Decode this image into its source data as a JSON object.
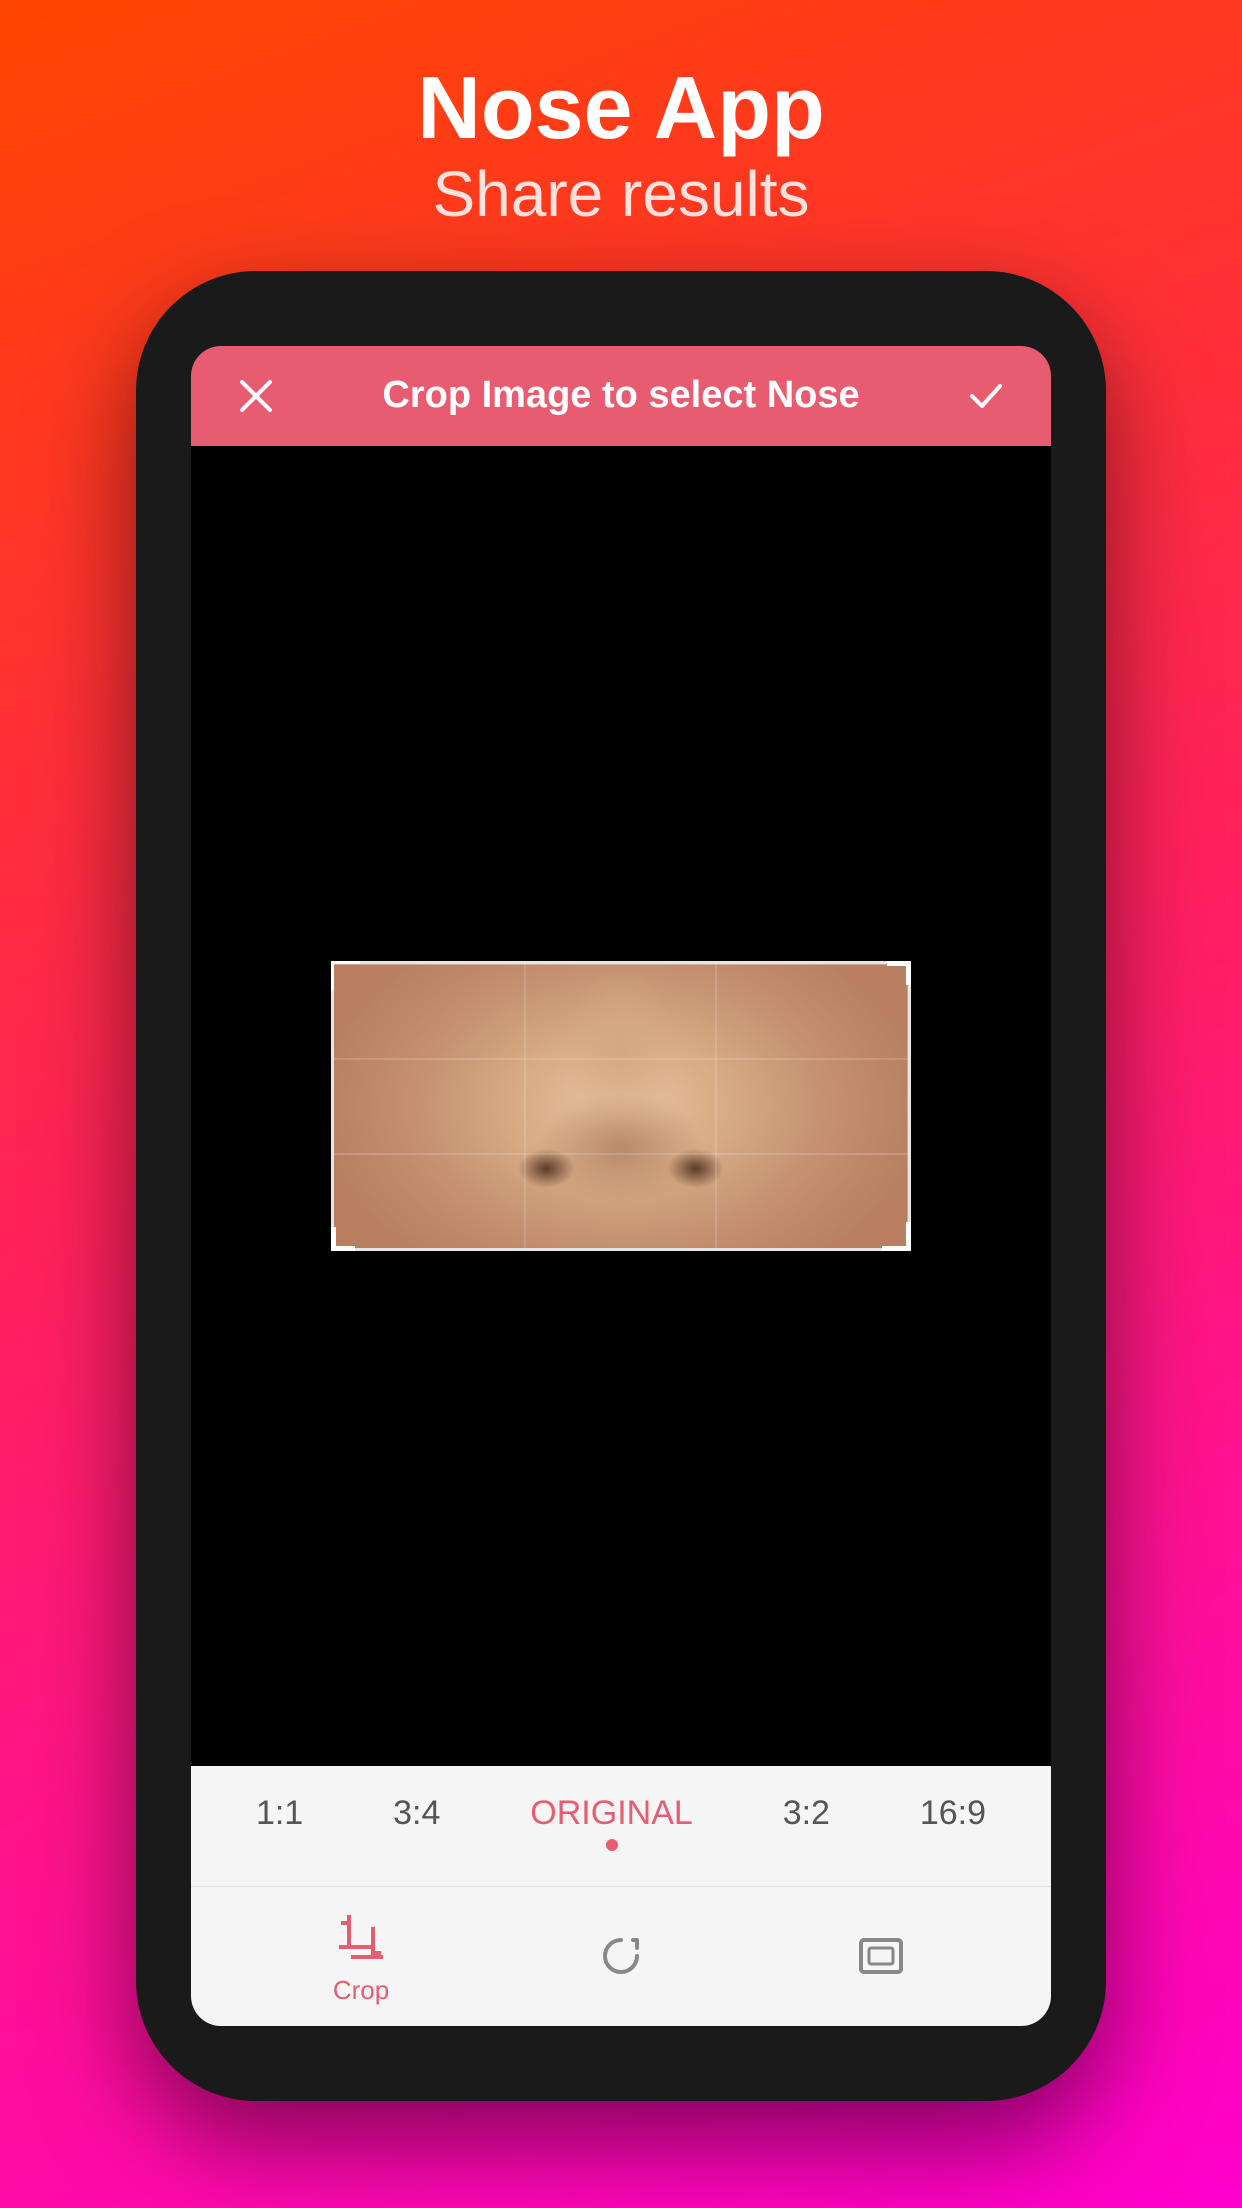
{
  "header": {
    "title": "Nose App",
    "subtitle": "Share results"
  },
  "topBar": {
    "title": "Crop Image to select Nose",
    "closeLabel": "×",
    "checkLabel": "✓",
    "backgroundColor": "#e85c72"
  },
  "ratioBar": {
    "options": [
      {
        "label": "1:1",
        "active": false
      },
      {
        "label": "3:4",
        "active": false
      },
      {
        "label": "ORIGINAL",
        "active": true
      },
      {
        "label": "3:2",
        "active": false
      },
      {
        "label": "16:9",
        "active": false
      }
    ]
  },
  "toolbar": {
    "items": [
      {
        "label": "Crop",
        "active": true,
        "icon": "crop-icon"
      },
      {
        "label": "",
        "active": false,
        "icon": "rotate-icon"
      },
      {
        "label": "",
        "active": false,
        "icon": "aspect-icon"
      }
    ]
  },
  "colors": {
    "accent": "#e85c72",
    "background": "#000000",
    "toolbarBg": "#f5f5f5"
  }
}
